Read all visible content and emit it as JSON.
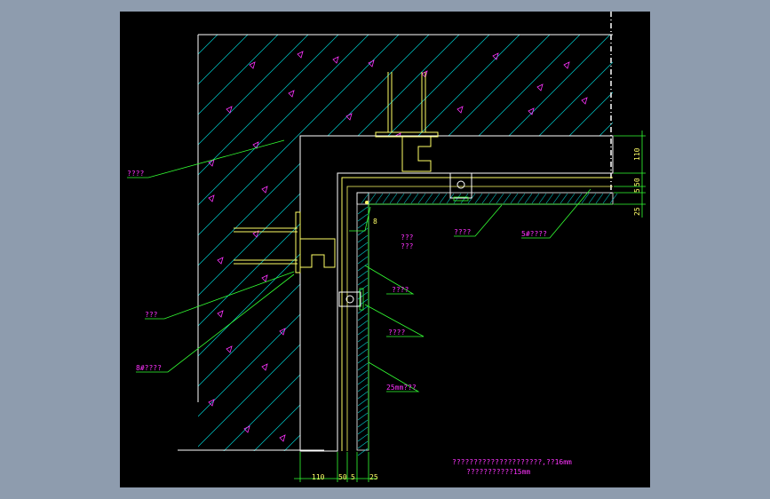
{
  "colors": {
    "background": "#8e9cae",
    "canvas": "#000000",
    "hatch": "#00cccc",
    "outline": "#ffffff",
    "structure": "#ffff66",
    "leader": "#33ff33",
    "text": "#ff33ff",
    "dimension": "#ffff66"
  },
  "labels": {
    "wall": "????",
    "anchor": "???",
    "angle_steel": "8#????",
    "bracket": "???",
    "bracket2": "???",
    "bolt_left": "????",
    "gap": "????",
    "stone": "25mm???",
    "keel": "????",
    "angle5": "5#????",
    "small_num": "8"
  },
  "dimensions": {
    "bottom": [
      "110",
      "50",
      "5",
      "25"
    ],
    "right": [
      "110",
      "50",
      "5",
      "25"
    ]
  },
  "notes": {
    "line1": "?????????????????????,??16mm",
    "line2": "???????????15mm"
  }
}
